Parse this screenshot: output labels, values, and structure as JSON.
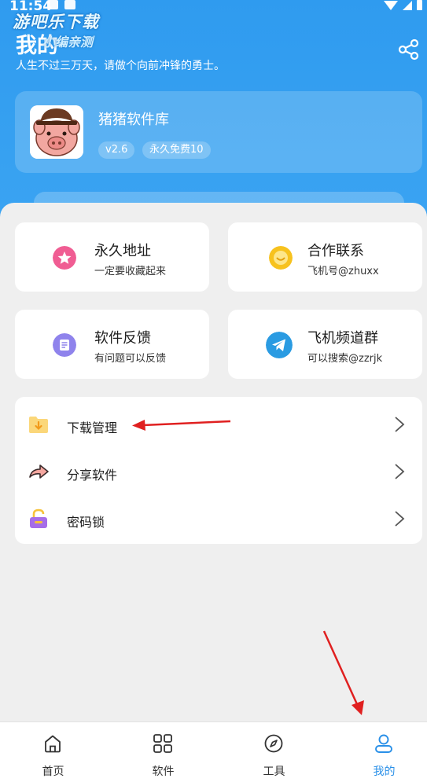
{
  "status": {
    "time": "11:54"
  },
  "watermark": {
    "line1": "游吧乐下载",
    "line2": "小编亲测"
  },
  "header": {
    "title": "我的",
    "motto": "人生不过三万天，请做个向前冲锋的勇士。",
    "share_icon": "share-icon"
  },
  "app_card": {
    "name": "猪猪软件库",
    "version": "v2.6",
    "badge": "永久免费10"
  },
  "tiles": [
    {
      "title": "永久地址",
      "subtitle": "一定要收藏起来",
      "icon": "star-icon",
      "color": "#f05d93"
    },
    {
      "title": "合作联系",
      "subtitle": "飞机号@zhuxx",
      "icon": "smile-icon",
      "color": "#f7c21e"
    },
    {
      "title": "软件反馈",
      "subtitle": "有问题可以反馈",
      "icon": "feedback-icon",
      "color": "#8f83ec"
    },
    {
      "title": "飞机频道群",
      "subtitle": "可以搜索@zzrjk",
      "icon": "telegram-icon",
      "color": "#2a9be2"
    }
  ],
  "menu": [
    {
      "label": "下载管理",
      "icon": "folder-download-icon"
    },
    {
      "label": "分享软件",
      "icon": "share-arrow-icon"
    },
    {
      "label": "密码锁",
      "icon": "lock-icon"
    }
  ],
  "nav": [
    {
      "label": "首页",
      "icon": "home-icon"
    },
    {
      "label": "软件",
      "icon": "grid-icon"
    },
    {
      "label": "工具",
      "icon": "compass-icon"
    },
    {
      "label": "我的",
      "icon": "user-icon",
      "active": true
    }
  ],
  "colors": {
    "primary": "#2f9bef",
    "active_nav": "#2a90e8",
    "annotation_arrow": "#e02020"
  }
}
